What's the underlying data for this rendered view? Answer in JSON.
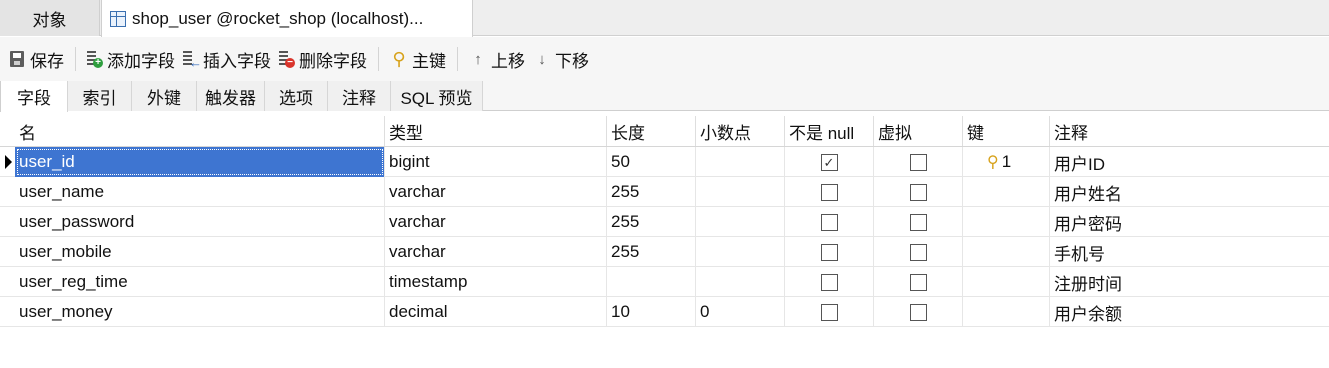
{
  "doc_tabs": {
    "objects_label": "对象",
    "active_label": "shop_user @rocket_shop (localhost)..."
  },
  "toolbar": {
    "save": "保存",
    "add_field": "添加字段",
    "insert_field": "插入字段",
    "delete_field": "删除字段",
    "primary_key": "主键",
    "move_up": "上移",
    "move_down": "下移"
  },
  "sub_tabs": [
    "字段",
    "索引",
    "外键",
    "触发器",
    "选项",
    "注释",
    "SQL 预览"
  ],
  "grid": {
    "columns": [
      "名",
      "类型",
      "长度",
      "小数点",
      "不是 null",
      "虚拟",
      "键",
      "注释"
    ],
    "rows": [
      {
        "name": "user_id",
        "type": "bigint",
        "length": "50",
        "decimals": "",
        "not_null": true,
        "virtual": false,
        "key": "1",
        "comment": "用户ID"
      },
      {
        "name": "user_name",
        "type": "varchar",
        "length": "255",
        "decimals": "",
        "not_null": false,
        "virtual": false,
        "key": "",
        "comment": "用户姓名"
      },
      {
        "name": "user_password",
        "type": "varchar",
        "length": "255",
        "decimals": "",
        "not_null": false,
        "virtual": false,
        "key": "",
        "comment": "用户密码"
      },
      {
        "name": "user_mobile",
        "type": "varchar",
        "length": "255",
        "decimals": "",
        "not_null": false,
        "virtual": false,
        "key": "",
        "comment": "手机号"
      },
      {
        "name": "user_reg_time",
        "type": "timestamp",
        "length": "",
        "decimals": "",
        "not_null": false,
        "virtual": false,
        "key": "",
        "comment": "注册时间"
      },
      {
        "name": "user_money",
        "type": "decimal",
        "length": "10",
        "decimals": "0",
        "not_null": false,
        "virtual": false,
        "key": "",
        "comment": "用户余额"
      }
    ],
    "selected_row": 0
  },
  "colors": {
    "selection": "#3e75d1",
    "key_icon": "#d7a21b"
  }
}
